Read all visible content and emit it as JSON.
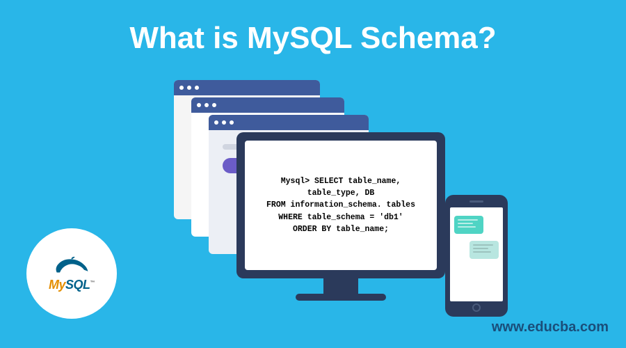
{
  "title": "What is MySQL Schema?",
  "sql": {
    "line1": "Mysql> SELECT table_name,",
    "line2": "table_type, DB",
    "line3": "FROM information_schema. tables",
    "line4": "WHERE table_schema = 'db1'",
    "line5": "ORDER BY table_name;"
  },
  "logo": {
    "my": "My",
    "sql": "SQL",
    "tm": "™"
  },
  "url": "www.educba.com"
}
